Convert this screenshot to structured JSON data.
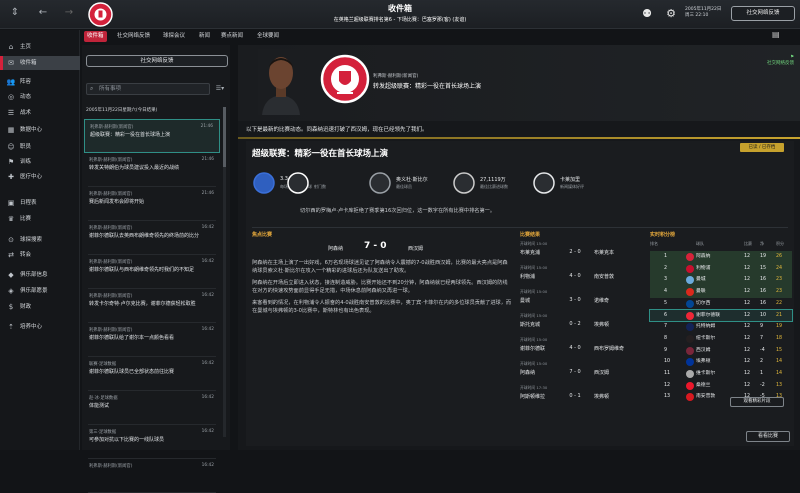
{
  "top": {
    "title": "收件箱",
    "line2": "在英格兰超级联赛排名第6 - 下场比赛：巴塞罗那(客) (友谊)",
    "date_line1": "2005年11月22日",
    "date_line2": "周三 22:10",
    "continue": "社交网络反馈"
  },
  "subtabs": [
    "收件箱",
    "社交网络反馈",
    "球探会议",
    "新闻",
    "赛点新闻",
    "全球要闻"
  ],
  "sidebar": [
    {
      "icon": "house-icon",
      "glyph": "⌂",
      "label": "主页"
    },
    {
      "icon": "inbox-icon",
      "glyph": "✉",
      "label": "收件箱"
    },
    {
      "icon": "squad-icon",
      "glyph": "👥",
      "label": "阵容"
    },
    {
      "icon": "dynamics-icon",
      "glyph": "◎",
      "label": "动态"
    },
    {
      "icon": "tactics-icon",
      "glyph": "☰",
      "label": "战术"
    },
    {
      "icon": "data-icon",
      "glyph": "▦",
      "label": "数据中心"
    },
    {
      "icon": "staff-icon",
      "glyph": "☺",
      "label": "职员"
    },
    {
      "icon": "training-icon",
      "glyph": "⚑",
      "label": "训练"
    },
    {
      "icon": "medical-icon",
      "glyph": "✚",
      "label": "医疗中心"
    },
    {
      "icon": "calendar-icon",
      "glyph": "▣",
      "label": "日程表"
    },
    {
      "icon": "competitions-icon",
      "glyph": "♛",
      "label": "比赛"
    },
    {
      "icon": "scouting-icon",
      "glyph": "⊙",
      "label": "球探搜索"
    },
    {
      "icon": "transfers-icon",
      "glyph": "⇄",
      "label": "转会"
    },
    {
      "icon": "club-info-icon",
      "glyph": "◆",
      "label": "俱乐部信息"
    },
    {
      "icon": "club-vision-icon",
      "glyph": "◈",
      "label": "俱乐部愿景"
    },
    {
      "icon": "finances-icon",
      "glyph": "$",
      "label": "财政"
    },
    {
      "icon": "development-icon",
      "glyph": "⇡",
      "label": "培养中心"
    }
  ],
  "inbox": {
    "social_btn": "社交网络反馈",
    "search_placeholder": "所有事项",
    "date_header": "2005年11月22日星期六(今日结果)",
    "messages": [
      {
        "from": "利弗斯·赫利斯(新闻官)",
        "title": "超级联赛：精彩一役在首长球场上演",
        "time": "21:46",
        "selected": true
      },
      {
        "from": "利弗斯·赫利斯(新闻官)",
        "title": "转发关特朗伯为球员建议投入最近的战绩",
        "time": "21:46"
      },
      {
        "from": "利弗斯·赫利斯(新闻官)",
        "title": "赛后新闻发布会即将开始",
        "time": "21:46"
      },
      {
        "from": "利弗斯·赫利斯(新闻官)",
        "title": "谢菲尔德联队去英西布朗维奇领先的终场前的比分",
        "time": "16:42"
      },
      {
        "from": "利弗斯·赫利斯(新闻官)",
        "title": "谢菲尔德联队与西布朗维奇领先时我们的不知足",
        "time": "16:42"
      },
      {
        "from": "利弗斯·赫利斯(新闻官)",
        "title": "转发卡尔奇特·卢尔克比赛，谢菲尔德获轻松取胜",
        "time": "16:42"
      },
      {
        "from": "利弗斯·赫利斯(新闻官)",
        "title": "谢菲尔德联队给了谢尔本一点颜色看看",
        "time": "16:42"
      },
      {
        "from": "联赛·足球数据",
        "title": "谢菲尔德联队球员已全部状态前往比赛",
        "time": "16:42"
      },
      {
        "from": "赵·冰·足球数据",
        "title": "体能测试",
        "time": "16:42"
      },
      {
        "from": "第三·足球数据",
        "title": "可参加对抗以下比赛的一线队球员",
        "time": "16:42"
      },
      {
        "from": "利弗斯·赫利斯(新闻官)",
        "title": "",
        "time": "16:42"
      }
    ]
  },
  "header": {
    "from": "利弗斯·赫利斯(新闻官)",
    "title": "转发超级联赛：精彩一役在首长球场上演",
    "social": "社交网络反馈"
  },
  "intro": "以下是最新的比赛动态。同森纳迅速打破了西汉姆，现在已经领先了我们。",
  "panel": {
    "read_btn": "已读 / 已存档",
    "title": "超级联赛：精彩一役在首长球场上演",
    "stats": [
      {
        "value": "3.3",
        "label": "每场比赛平均进球"
      },
      {
        "value": "",
        "label": "射门数"
      },
      {
        "value": "奥义杜·斯比尔",
        "label": "最佳球员"
      },
      {
        "value": "27,1119万",
        "label": "最佳比赛进球数"
      },
      {
        "value": "卡莱加里",
        "label": "新闻媒体好评"
      }
    ],
    "caption": "切尔西的罗梅卢·卢卡库拒绝了赛季第16次回归位，这一数字在所有比赛中排名第一。",
    "section_match": "焦点比赛",
    "score_home": "阿森纳",
    "score": "7 - 0",
    "score_away": "西汉姆",
    "body": [
      "阿森纳在主场上演了一出好戏，6万名现场球迷见证了阿森纳令人震撼的7-0战胜西汉姆，比赛的最大亮点是阿森纳球员索义杜·斯比尔在攻入一个精彩的进球后还为队友送出了助攻。",
      "阿森纳在开场后立即进入状态，接连制造威胁。比赛开始还不到20分钟，阿森纳就已经两球领先。西汉姆的防线在对方的快速攻势面前显得手足无措，中场休息前阿森纳又再进一球。",
      "来客看到的情况，在利物浦令人振奋的4-0战胜南安普敦的比赛中，奥丁宾·卡菲尔在内的多位球员贡献了进球，而在曼城与埃弗顿的3-0比赛中，斯特林也有出色表现。"
    ],
    "section_results": "比赛结果",
    "results": [
      {
        "date": "开球时间 15:00",
        "home": "布莱克浦",
        "score": "2 - 0",
        "away": "布莱克本"
      },
      {
        "date": "开球时间 15:00",
        "home": "利物浦",
        "score": "4 - 0",
        "away": "南安普敦"
      },
      {
        "date": "开球时间 15:00",
        "home": "曼城",
        "score": "3 - 0",
        "away": "诺维奇"
      },
      {
        "date": "开球时间 15:00",
        "home": "斯托克城",
        "score": "0 - 2",
        "away": "埃弗顿"
      },
      {
        "date": "开球时间 15:00",
        "home": "谢菲尔德联",
        "score": "4 - 0",
        "away": "西布罗姆维奇"
      },
      {
        "date": "开球时间 15:00",
        "home": "阿森纳",
        "score": "7 - 0",
        "away": "西汉姆"
      },
      {
        "date": "开球时间 17:30",
        "home": "阿斯顿维拉",
        "score": "0 - 1",
        "away": "埃弗顿"
      }
    ],
    "section_table": "实时积分榜",
    "table_head": [
      "排名",
      "",
      "球队",
      "比赛",
      "净",
      "积分"
    ],
    "table": [
      {
        "pos": "1",
        "team": "阿森纳",
        "p": "12",
        "gd": "19",
        "pts": "26",
        "color": "#d6233a",
        "hl": true
      },
      {
        "pos": "2",
        "team": "利物浦",
        "p": "12",
        "gd": "15",
        "pts": "24",
        "color": "#c8102e",
        "hl": true
      },
      {
        "pos": "3",
        "team": "曼城",
        "p": "12",
        "gd": "16",
        "pts": "23",
        "color": "#6cabdd",
        "hl": true
      },
      {
        "pos": "4",
        "team": "曼联",
        "p": "12",
        "gd": "16",
        "pts": "23",
        "color": "#da291c",
        "hl": true
      },
      {
        "pos": "5",
        "team": "切尔西",
        "p": "12",
        "gd": "16",
        "pts": "22",
        "color": "#034694"
      },
      {
        "pos": "6",
        "team": "谢菲尔德联",
        "p": "12",
        "gd": "10",
        "pts": "21",
        "color": "#ee2737",
        "sel": true
      },
      {
        "pos": "7",
        "team": "托特纳姆",
        "p": "12",
        "gd": "9",
        "pts": "19",
        "color": "#132257"
      },
      {
        "pos": "8",
        "team": "纽卡斯尔",
        "p": "12",
        "gd": "7",
        "pts": "18",
        "color": "#241f20"
      },
      {
        "pos": "9",
        "team": "西汉姆",
        "p": "12",
        "gd": "-4",
        "pts": "15",
        "color": "#7a263a"
      },
      {
        "pos": "10",
        "team": "埃弗顿",
        "p": "12",
        "gd": "2",
        "pts": "14",
        "color": "#003399"
      },
      {
        "pos": "11",
        "team": "维卡斯尔",
        "p": "12",
        "gd": "1",
        "pts": "14",
        "color": "#aaaaaa"
      },
      {
        "pos": "12",
        "team": "桑德兰",
        "p": "12",
        "gd": "-2",
        "pts": "13",
        "color": "#eb172b"
      },
      {
        "pos": "13",
        "team": "南安普敦",
        "p": "12",
        "gd": "-5",
        "pts": "13",
        "color": "#d71920"
      }
    ],
    "view_table": "观看精彩片段",
    "view_matches": "看看比赛"
  }
}
